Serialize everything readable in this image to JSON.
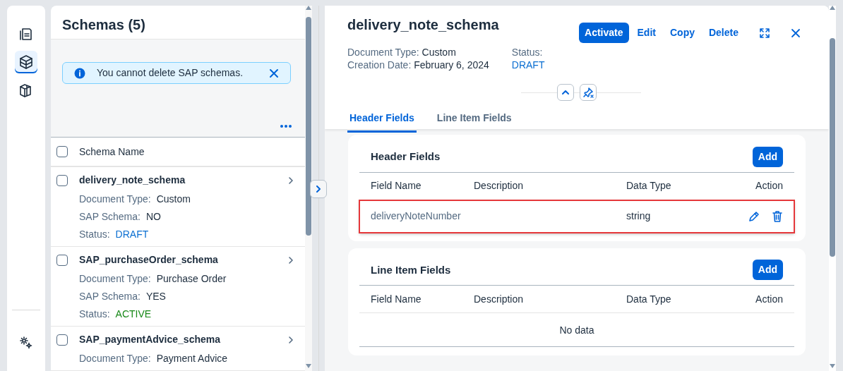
{
  "nav_rail": {
    "items": [
      {
        "kind": "documents",
        "selected": false
      },
      {
        "kind": "schemas",
        "selected": true
      },
      {
        "kind": "templates",
        "selected": false
      }
    ],
    "footer": {
      "kind": "settings"
    }
  },
  "list_panel": {
    "title": "Schemas (5)",
    "message": {
      "text": "You cannot delete SAP schemas."
    },
    "column_header": {
      "label": "Schema Name",
      "checked": false
    },
    "items": [
      {
        "name": "delivery_note_schema",
        "checked": false,
        "fields": [
          {
            "label": "Document Type:",
            "value": "Custom"
          },
          {
            "label": "SAP Schema:",
            "value": "NO"
          },
          {
            "label": "Status:",
            "value": "DRAFT",
            "color": "#0a6ed1"
          }
        ]
      },
      {
        "name": "SAP_purchaseOrder_schema",
        "checked": false,
        "fields": [
          {
            "label": "Document Type:",
            "value": "Purchase Order"
          },
          {
            "label": "SAP Schema:",
            "value": "YES"
          },
          {
            "label": "Status:",
            "value": "ACTIVE",
            "color": "#188918"
          }
        ]
      },
      {
        "name": "SAP_paymentAdvice_schema",
        "checked": false,
        "fields": [
          {
            "label": "Document Type:",
            "value": "Payment Advice"
          }
        ]
      }
    ]
  },
  "detail": {
    "title": "delivery_note_schema",
    "actions": [
      {
        "label": "Activate",
        "kind": "primary"
      },
      {
        "label": "Edit",
        "kind": "link"
      },
      {
        "label": "Copy",
        "kind": "link"
      },
      {
        "label": "Delete",
        "kind": "link"
      }
    ],
    "meta": [
      {
        "lines": [
          {
            "label": "Document Type:",
            "value": "Custom"
          },
          {
            "label": "Creation Date:",
            "value": "February 6, 2024"
          }
        ]
      },
      {
        "label": "Status:",
        "value": "DRAFT",
        "color": "#0a6ed1"
      }
    ],
    "tabs": [
      {
        "label": "Header Fields",
        "selected": true
      },
      {
        "label": "Line Item Fields",
        "selected": false
      }
    ],
    "sections": [
      {
        "title": "Header Fields",
        "add": "Add",
        "columns": [
          "Field Name",
          "Description",
          "Data Type",
          "Action"
        ],
        "rows": [
          {
            "cells": [
              "deliveryNoteNumber",
              "",
              "string"
            ],
            "highlighted": true
          }
        ]
      },
      {
        "title": "Line Item Fields",
        "add": "Add",
        "columns": [
          "Field Name",
          "Description",
          "Data Type",
          "Action"
        ],
        "empty": "No data"
      }
    ]
  }
}
